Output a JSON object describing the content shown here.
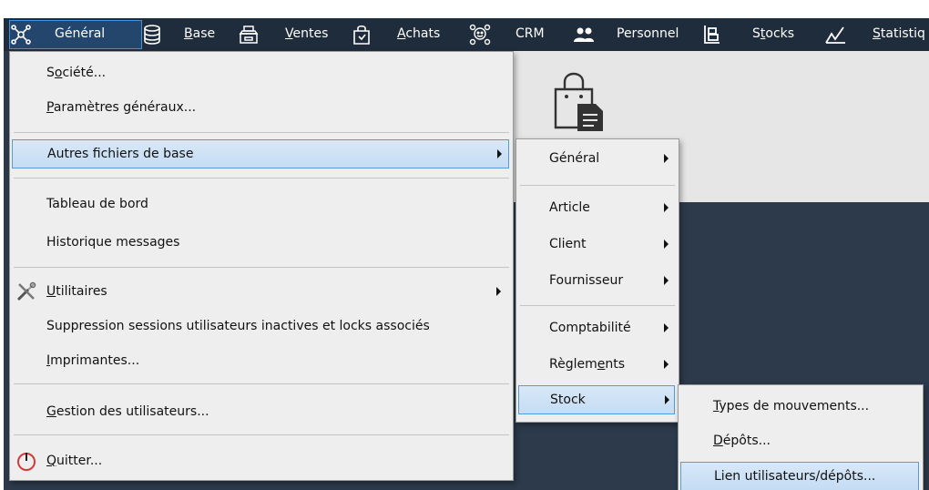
{
  "menubar": {
    "items": [
      {
        "label": "Général",
        "underline": "",
        "icon": "network-icon"
      },
      {
        "label": "Base",
        "underline": "B",
        "icon": "database-icon"
      },
      {
        "label": "Ventes",
        "underline": "V",
        "icon": "cash-register-icon"
      },
      {
        "label": "Achats",
        "underline": "A",
        "icon": "shopping-bag-icon"
      },
      {
        "label": "CRM",
        "underline": "",
        "icon": "crm-group-icon"
      },
      {
        "label": "Personnel",
        "underline": "",
        "icon": "people-icon"
      },
      {
        "label": "Stocks",
        "underline": "t",
        "icon": "hand-truck-icon"
      },
      {
        "label": "Statistiq",
        "underline": "S",
        "icon": "chart-line-icon"
      }
    ]
  },
  "menu_general": {
    "items": [
      {
        "pre": "S",
        "ul": "o",
        "post": "ciété..."
      },
      {
        "pre": "",
        "ul": "P",
        "post": "aramètres généraux..."
      },
      {
        "pre": "Autres fichiers de base",
        "ul": "",
        "post": ""
      },
      {
        "pre": "Tableau de bord",
        "ul": "",
        "post": ""
      },
      {
        "pre": "Historique messages",
        "ul": "",
        "post": ""
      },
      {
        "pre": "",
        "ul": "U",
        "post": "tilitaires"
      },
      {
        "pre": "Suppression sessions utilisateurs inactives et locks associés",
        "ul": "",
        "post": ""
      },
      {
        "pre": "",
        "ul": "I",
        "post": "mprimantes..."
      },
      {
        "pre": "",
        "ul": "G",
        "post": "estion des utilisateurs..."
      },
      {
        "pre": "",
        "ul": "Q",
        "post": "uitter..."
      }
    ]
  },
  "menu_autres": {
    "items": [
      {
        "pre": "Général",
        "ul": "",
        "post": ""
      },
      {
        "pre": "Article",
        "ul": "",
        "post": ""
      },
      {
        "pre": "Client",
        "ul": "",
        "post": ""
      },
      {
        "pre": "Fournisseur",
        "ul": "",
        "post": ""
      },
      {
        "pre": "Comptabilité",
        "ul": "",
        "post": ""
      },
      {
        "pre": "Règlem",
        "ul": "e",
        "post": "nts"
      },
      {
        "pre": "Stock",
        "ul": "",
        "post": ""
      }
    ]
  },
  "menu_stock": {
    "items": [
      {
        "pre": "",
        "ul": "T",
        "post": "ypes de mouvements..."
      },
      {
        "pre": "",
        "ul": "D",
        "post": "épôts..."
      },
      {
        "pre": "Lien utilisateurs/dépôts...",
        "ul": "",
        "post": ""
      }
    ]
  },
  "colors": {
    "menubar_bg": "#1f2c3c",
    "frame_bg": "#2d3a4b",
    "menu_bg": "#eeeeee",
    "highlight_border": "#5b9bd5"
  }
}
